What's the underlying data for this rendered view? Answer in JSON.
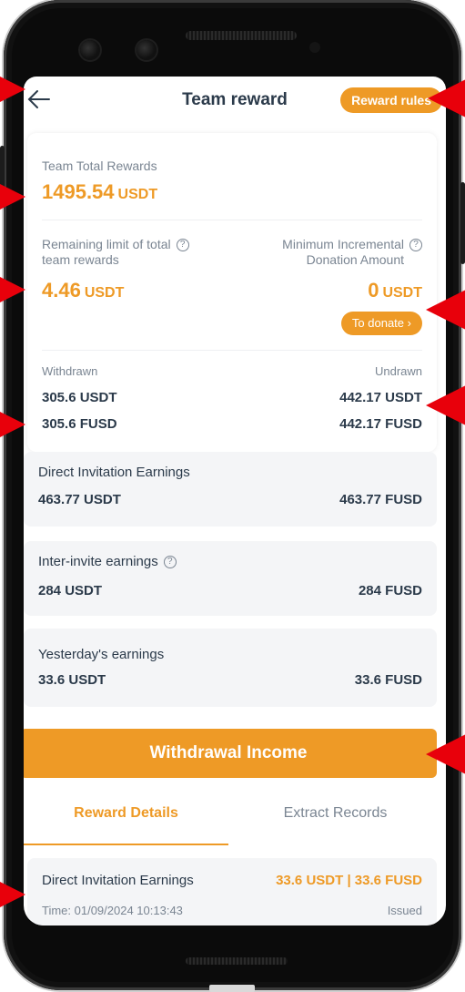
{
  "header": {
    "title": "Team reward",
    "rules_label": "Reward rules"
  },
  "summary": {
    "team_total_label": "Team Total Rewards",
    "team_total_value": "1495.54",
    "team_total_unit": "USDT",
    "remaining_label_line1": "Remaining limit of total",
    "remaining_label_line2": "team rewards",
    "remaining_value": "4.46",
    "remaining_unit": "USDT",
    "min_label_line1": "Minimum Incremental",
    "min_label_line2": "Donation Amount",
    "min_value": "0",
    "min_unit": "USDT",
    "donate_label": "To donate",
    "withdrawn_label": "Withdrawn",
    "undrawn_label": "Undrawn",
    "withdrawn_usdt": "305.6 USDT",
    "withdrawn_fusd": "305.6 FUSD",
    "undrawn_usdt": "442.17 USDT",
    "undrawn_fusd": "442.17 FUSD"
  },
  "earnings": [
    {
      "label": "Direct Invitation Earnings",
      "usdt": "463.77 USDT",
      "fusd": "463.77 FUSD"
    },
    {
      "label": "Inter-invite earnings",
      "usdt": "284 USDT",
      "fusd": "284 FUSD"
    },
    {
      "label": "Yesterday's earnings",
      "usdt": "33.6 USDT",
      "fusd": "33.6 FUSD"
    }
  ],
  "withdraw_button": "Withdrawal Income",
  "tabs": [
    {
      "label": "Reward Details",
      "active": true
    },
    {
      "label": "Extract Records",
      "active": false
    }
  ],
  "records": [
    {
      "title": "Direct Invitation Earnings",
      "amount": "33.6 USDT | 33.6 FUSD",
      "time": "Time: 01/09/2024 10:13:43",
      "status": "Issued"
    }
  ],
  "colors": {
    "accent": "#ee9a26",
    "annotation": "#e8000b",
    "panel_bg": "#f4f5f7"
  }
}
